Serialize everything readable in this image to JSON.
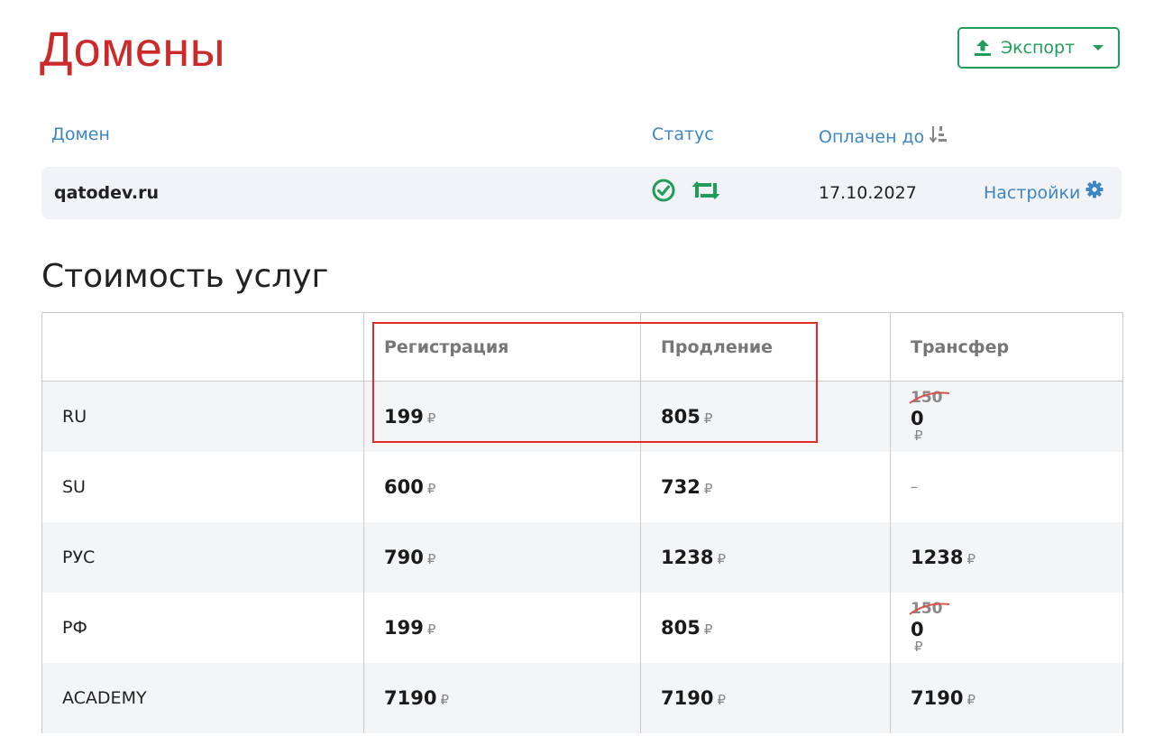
{
  "page": {
    "title": "Домены"
  },
  "toolbar": {
    "export_label": "Экспорт"
  },
  "domains_table": {
    "headers": {
      "domain": "Домен",
      "status": "Статус",
      "paid_until": "Оплачен до"
    },
    "rows": [
      {
        "domain": "qatodev.ru",
        "paid_until": "17.10.2027",
        "settings_label": "Настройки"
      }
    ]
  },
  "pricing": {
    "title": "Стоимость услуг",
    "currency": "₽",
    "columns": [
      "",
      "Регистрация",
      "Продление",
      "Трансфер"
    ],
    "rows": [
      {
        "zone": "RU",
        "registration": "199",
        "renewal": "805",
        "transfer_old": "150",
        "transfer": "0"
      },
      {
        "zone": "SU",
        "registration": "600",
        "renewal": "732",
        "transfer": "–"
      },
      {
        "zone": "РУС",
        "registration": "790",
        "renewal": "1238",
        "transfer": "1238"
      },
      {
        "zone": "РФ",
        "registration": "199",
        "renewal": "805",
        "transfer_old": "150",
        "transfer": "0"
      },
      {
        "zone": "ACADEMY",
        "registration": "7190",
        "renewal": "7190",
        "transfer": "7190"
      }
    ]
  },
  "colors": {
    "title": "#cc2a2a",
    "accent_green": "#1e9e58",
    "link_blue": "#3d86c6",
    "highlight_red": "#e12b2b"
  },
  "icons": {
    "export": "upload-icon",
    "dropdown": "caret-down-icon",
    "sort": "sort-numeric-icon",
    "status_ok": "check-circle-icon",
    "status_renew": "retweet-icon",
    "settings": "gear-icon"
  }
}
